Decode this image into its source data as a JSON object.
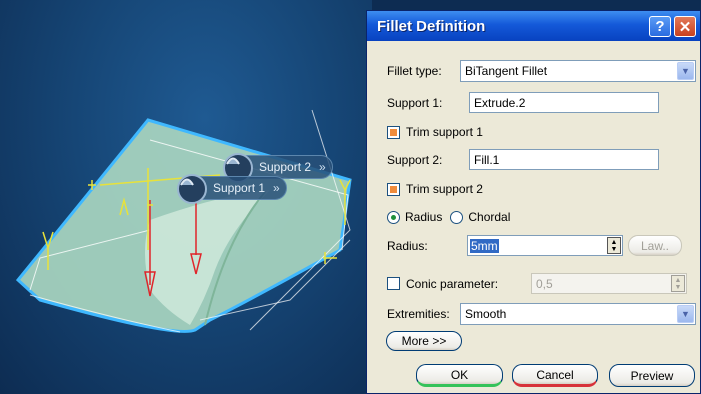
{
  "viewport": {
    "support1_label": "Support 1",
    "support2_label": "Support 2",
    "chevron": "»"
  },
  "dialog": {
    "title": "Fillet Definition",
    "help_button": "?",
    "close_button": "✕",
    "fillet_type_label": "Fillet type:",
    "fillet_type_value": "BiTangent Fillet",
    "support1_label": "Support 1:",
    "support1_value": "Extrude.2",
    "trim_support1_label": "Trim support 1",
    "trim_support1_checked": true,
    "support2_label": "Support 2:",
    "support2_value": "Fill.1",
    "trim_support2_label": "Trim support 2",
    "trim_support2_checked": true,
    "radius_option_label": "Radius",
    "chordal_option_label": "Chordal",
    "selected_mode": "Radius",
    "radius_label": "Radius:",
    "radius_value": "5mm",
    "law_button": "Law..",
    "conic_label": "Conic parameter:",
    "conic_value": "0,5",
    "conic_checked": false,
    "extremities_label": "Extremities:",
    "extremities_value": "Smooth",
    "more_button": "More >>",
    "ok_button": "OK",
    "cancel_button": "Cancel",
    "preview_button": "Preview"
  },
  "colors": {
    "titlebar": "#0842c0",
    "surface": "#a9d6c0",
    "edge_highlight": "#3fb8ff",
    "arrow": "#e0252a",
    "axis": "#e8e23a"
  }
}
